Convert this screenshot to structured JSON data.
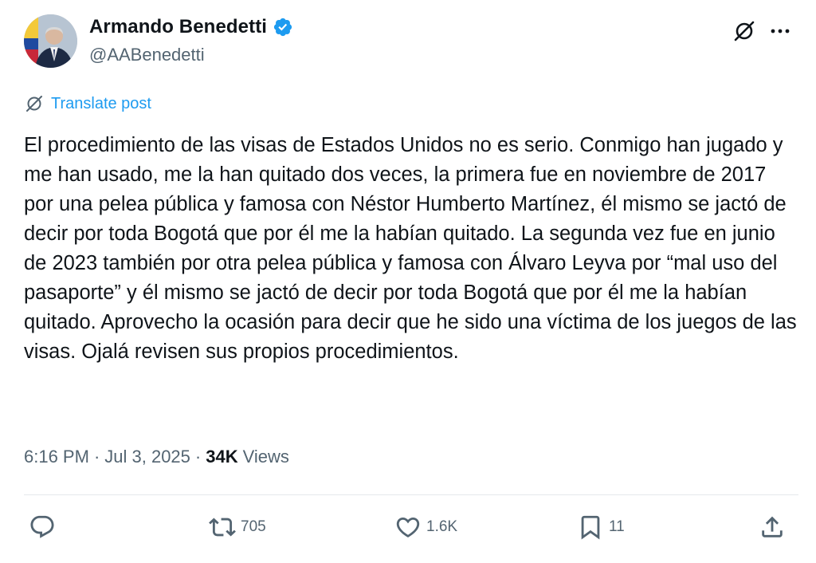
{
  "author": {
    "display_name": "Armando Benedetti",
    "handle": "@AABenedetti"
  },
  "translate_label": "Translate post",
  "post_text": "El procedimiento de las visas de Estados Unidos no es serio. Conmigo han jugado y me han usado, me la han quitado dos veces, la primera fue en noviembre de 2017 por una pelea pública y famosa con Néstor Humberto Martínez, él mismo se jactó de decir por toda Bogotá que por él me la habían quitado. La segunda vez fue en junio de 2023 también por otra pelea pública y famosa con Álvaro Leyva por “mal uso del pasaporte” y él mismo se jactó de decir por toda Bogotá que por él me la habían quitado. Aprovecho la ocasión para decir que he sido una víctima de los juegos de las visas. Ojalá revisen sus propios procedimientos.",
  "meta": {
    "time": "6:16 PM",
    "separator": "·",
    "date": "Jul 3, 2025",
    "views_count": "34K",
    "views_label": "Views"
  },
  "actions": {
    "reply": {
      "icon": "reply-icon",
      "count": ""
    },
    "repost": {
      "icon": "repost-icon",
      "count": "705"
    },
    "like": {
      "icon": "like-icon",
      "count": "1.6K"
    },
    "bookmark": {
      "icon": "bookmark-icon",
      "count": "11"
    },
    "share": {
      "icon": "share-icon",
      "count": ""
    }
  },
  "colors": {
    "accent": "#1d9bf0",
    "text": "#0f1419",
    "secondary": "#536471",
    "divider": "#e5e9ec"
  }
}
